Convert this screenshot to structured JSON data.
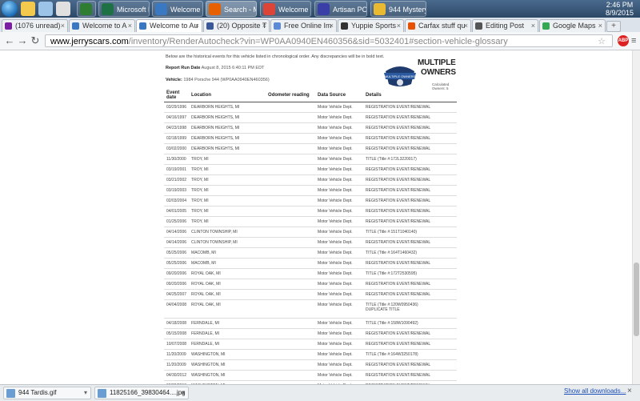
{
  "taskbar": {
    "buttons": [
      {
        "label": "",
        "color": "#2e7d32"
      },
      {
        "label": "Microsoft Excel n...",
        "color": "#1e7145"
      },
      {
        "label": "Welcome to Au...",
        "color": "#3b78c2"
      },
      {
        "label": "Search - Mozilla F...",
        "color": "#e66000"
      },
      {
        "label": "Welcome to Auto...",
        "color": "#db4437"
      },
      {
        "label": "Artisan POS Delux...",
        "color": "#3a3fa8"
      },
      {
        "label": "944 Mystery - Paint",
        "color": "#e8b931"
      }
    ],
    "time": "2:46 PM",
    "date": "8/9/2015"
  },
  "browser_tabs": [
    {
      "label": "(1076 unread)",
      "color": "#7b1fa2"
    },
    {
      "label": "Welcome to A",
      "color": "#3b78c2"
    },
    {
      "label": "Welcome to Au",
      "color": "#3b78c2"
    },
    {
      "label": "(20) Opposite T",
      "color": "#3b5998"
    },
    {
      "label": "Free Online Im",
      "color": "#5b8bd6"
    },
    {
      "label": "Yuppie Sports",
      "color": "#333333"
    },
    {
      "label": "Carfax stuff qu",
      "color": "#e65100"
    },
    {
      "label": "Editing Post",
      "color": "#555555"
    },
    {
      "label": "Google Maps",
      "color": "#34a853"
    }
  ],
  "address_bar": {
    "domain": "www.jerryscars.com",
    "path": "/inventory/RenderAutocheck?vin=WP0AA0940EN460356&sid=5032401#section-vehicle-glossary"
  },
  "report": {
    "intro": "Below are the historical events for this vehicle listed in chronological order. Any discrepancies will be in bold text.",
    "run_date_label": "Report Run Date",
    "run_date": "August 8, 2015 6:40:11 PM EDT",
    "vehicle_label": "Vehicle:",
    "vehicle": "1984 Porsche 944 (WP0AA0940EN460356)",
    "badge_line1": "MULTIPLE",
    "badge_line2": "OWNERS",
    "badge_shield": "MULTIPLE OWNERS",
    "calculated_owners": "Calculated Owners: 5",
    "columns": [
      "Event date",
      "Location",
      "Odometer reading",
      "Data Source",
      "Details"
    ],
    "rows": [
      {
        "date": "03/29/1996",
        "location": "DEARBORN HEIGHTS, MI",
        "odometer": "",
        "source": "Motor Vehicle Dept.",
        "details": "REGISTRATION EVENT/RENEWAL",
        "details2": ""
      },
      {
        "date": "04/16/1997",
        "location": "DEARBORN HEIGHTS, MI",
        "odometer": "",
        "source": "Motor Vehicle Dept.",
        "details": "REGISTRATION EVENT/RENEWAL",
        "details2": ""
      },
      {
        "date": "04/23/1998",
        "location": "DEARBORN HEIGHTS, MI",
        "odometer": "",
        "source": "Motor Vehicle Dept.",
        "details": "REGISTRATION EVENT/RENEWAL",
        "details2": ""
      },
      {
        "date": "02/18/1999",
        "location": "DEARBORN HEIGHTS, MI",
        "odometer": "",
        "source": "Motor Vehicle Dept.",
        "details": "REGISTRATION EVENT/RENEWAL",
        "details2": ""
      },
      {
        "date": "03/02/2000",
        "location": "DEARBORN HEIGHTS, MI",
        "odometer": "",
        "source": "Motor Vehicle Dept.",
        "details": "REGISTRATION EVENT/RENEWAL",
        "details2": ""
      },
      {
        "date": "11/30/2000",
        "location": "TROY, MI",
        "odometer": "",
        "source": "Motor Vehicle Dept.",
        "details": "TITLE (Title #:172L3220017)",
        "details2": ""
      },
      {
        "date": "03/19/2001",
        "location": "TROY, MI",
        "odometer": "",
        "source": "Motor Vehicle Dept.",
        "details": "REGISTRATION EVENT/RENEWAL",
        "details2": ""
      },
      {
        "date": "03/21/2002",
        "location": "TROY, MI",
        "odometer": "",
        "source": "Motor Vehicle Dept.",
        "details": "REGISTRATION EVENT/RENEWAL",
        "details2": ""
      },
      {
        "date": "03/19/2003",
        "location": "TROY, MI",
        "odometer": "",
        "source": "Motor Vehicle Dept.",
        "details": "REGISTRATION EVENT/RENEWAL",
        "details2": ""
      },
      {
        "date": "02/03/2004",
        "location": "TROY, MI",
        "odometer": "",
        "source": "Motor Vehicle Dept.",
        "details": "REGISTRATION EVENT/RENEWAL",
        "details2": ""
      },
      {
        "date": "04/01/2005",
        "location": "TROY, MI",
        "odometer": "",
        "source": "Motor Vehicle Dept.",
        "details": "REGISTRATION EVENT/RENEWAL",
        "details2": ""
      },
      {
        "date": "01/25/2006",
        "location": "TROY, MI",
        "odometer": "",
        "source": "Motor Vehicle Dept.",
        "details": "REGISTRATION EVENT/RENEWAL",
        "details2": ""
      },
      {
        "date": "04/14/2006",
        "location": "CLINTON TOWNSHIP, MI",
        "odometer": "",
        "source": "Motor Vehicle Dept.",
        "details": "TITLE (Title #:151T1040140)",
        "details2": ""
      },
      {
        "date": "04/14/2006",
        "location": "CLINTON TOWNSHIP, MI",
        "odometer": "",
        "source": "Motor Vehicle Dept.",
        "details": "REGISTRATION EVENT/RENEWAL",
        "details2": ""
      },
      {
        "date": "05/25/2006",
        "location": "MACOMB, MI",
        "odometer": "",
        "source": "Motor Vehicle Dept.",
        "details": "TITLE (Title #:164T1460432)",
        "details2": ""
      },
      {
        "date": "05/25/2006",
        "location": "MACOMB, MI",
        "odometer": "",
        "source": "Motor Vehicle Dept.",
        "details": "REGISTRATION EVENT/RENEWAL",
        "details2": ""
      },
      {
        "date": "09/20/2006",
        "location": "ROYAL OAK, MI",
        "odometer": "",
        "source": "Motor Vehicle Dept.",
        "details": "TITLE (Title #:172T2530595)",
        "details2": ""
      },
      {
        "date": "09/20/2006",
        "location": "ROYAL OAK, MI",
        "odometer": "",
        "source": "Motor Vehicle Dept.",
        "details": "REGISTRATION EVENT/RENEWAL",
        "details2": ""
      },
      {
        "date": "04/25/2007",
        "location": "ROYAL OAK, MI",
        "odometer": "",
        "source": "Motor Vehicle Dept.",
        "details": "REGISTRATION EVENT/RENEWAL",
        "details2": ""
      },
      {
        "date": "04/04/2008",
        "location": "ROYAL OAK, MI",
        "odometer": "",
        "source": "Motor Vehicle Dept.",
        "details": "TITLE (Title #:120W0950436)",
        "details2": "DUPLICATE TITLE"
      },
      {
        "date": "04/18/2008",
        "location": "FERNDALE, MI",
        "odometer": "",
        "source": "Motor Vehicle Dept.",
        "details": "TITLE (Title #:158W1090492)",
        "details2": ""
      },
      {
        "date": "05/15/2008",
        "location": "FERNDALE, MI",
        "odometer": "",
        "source": "Motor Vehicle Dept.",
        "details": "REGISTRATION EVENT/RENEWAL",
        "details2": ""
      },
      {
        "date": "10/07/2008",
        "location": "FERNDALE, MI",
        "odometer": "",
        "source": "Motor Vehicle Dept.",
        "details": "REGISTRATION EVENT/RENEWAL",
        "details2": ""
      },
      {
        "date": "11/20/2009",
        "location": "WASHINGTON, MI",
        "odometer": "",
        "source": "Motor Vehicle Dept.",
        "details": "TITLE (Title #:164W3250178)",
        "details2": ""
      },
      {
        "date": "11/20/2009",
        "location": "WASHINGTON, MI",
        "odometer": "",
        "source": "Motor Vehicle Dept.",
        "details": "REGISTRATION EVENT/RENEWAL",
        "details2": ""
      },
      {
        "date": "04/30/2012",
        "location": "WASHINGTON, MI",
        "odometer": "",
        "source": "Motor Vehicle Dept.",
        "details": "REGISTRATION EVENT/RENEWAL",
        "details2": ""
      },
      {
        "date": "03/29/2013",
        "location": "WASHINGTON, MI",
        "odometer": "",
        "source": "Motor Vehicle Dept.",
        "details": "REGISTRATION EVENT/RENEWAL",
        "details2": ""
      }
    ]
  },
  "downloads": {
    "items": [
      "944 Tardis.gif",
      "11825166_39830464....jpg"
    ],
    "show_all": "Show all downloads..."
  }
}
